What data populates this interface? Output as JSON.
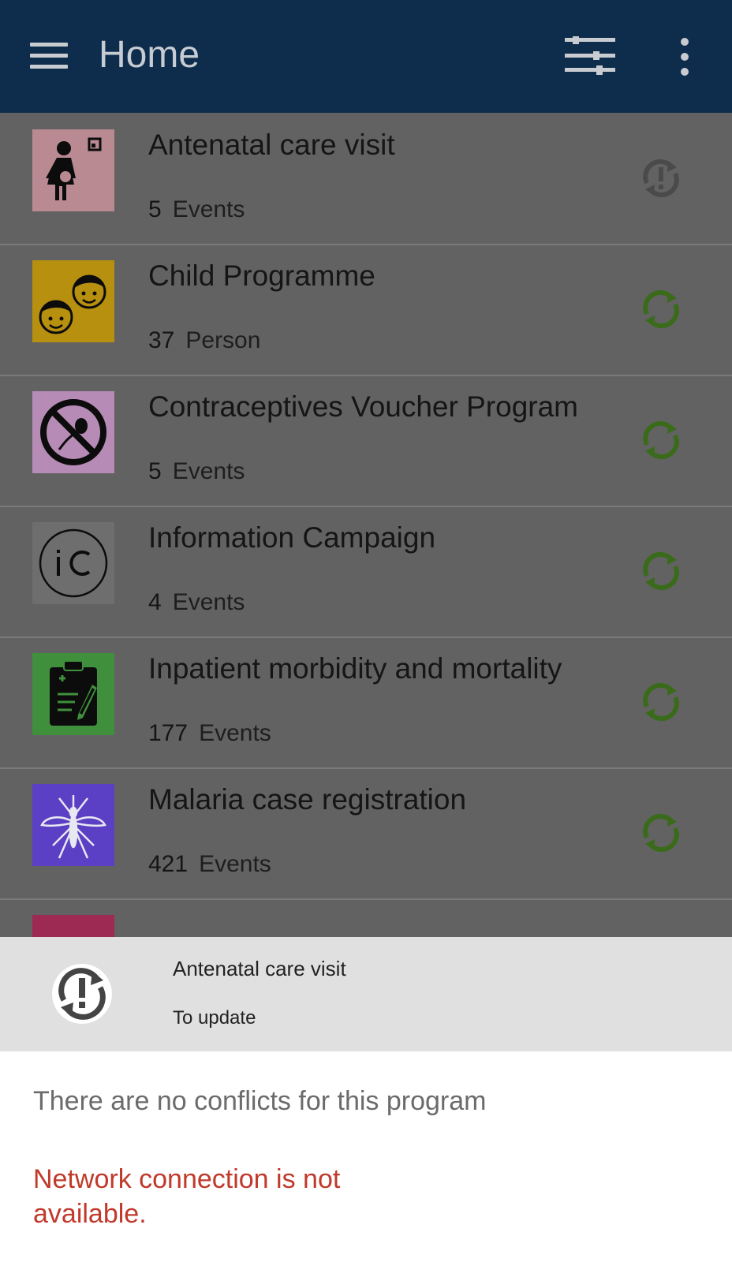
{
  "toolbar": {
    "title": "Home",
    "menu_icon": "hamburger-menu-icon",
    "filter_icon": "filter-sliders-icon",
    "more_icon": "more-vertical-icon"
  },
  "programs": [
    {
      "name": "Antenatal care visit",
      "count": "5",
      "unit": "Events",
      "icon": "pregnant-woman-icon",
      "icon_bg": "#b98a92",
      "sync_status": "to-update",
      "sync_color": "#4a4a4a"
    },
    {
      "name": "Child Programme",
      "count": "37",
      "unit": "Person",
      "icon": "children-faces-icon",
      "icon_bg": "#b8900f",
      "sync_status": "synced",
      "sync_color": "#3a6b1a"
    },
    {
      "name": "Contraceptives Voucher Program",
      "count": "5",
      "unit": "Events",
      "icon": "no-sperm-icon",
      "icon_bg": "#b68bb6",
      "sync_status": "synced",
      "sync_color": "#3a6b1a"
    },
    {
      "name": "Information Campaign",
      "count": "4",
      "unit": "Events",
      "icon": "ic-letters-icon",
      "icon_bg": "#6e6e6e",
      "sync_status": "synced",
      "sync_color": "#3a6b1a"
    },
    {
      "name": "Inpatient morbidity and mortality",
      "count": "177",
      "unit": "Events",
      "icon": "clipboard-icon",
      "icon_bg": "#3f8f3c",
      "sync_status": "synced",
      "sync_color": "#3a6b1a"
    },
    {
      "name": "Malaria case registration",
      "count": "421",
      "unit": "Events",
      "icon": "mosquito-icon",
      "icon_bg": "#5b3fc4",
      "sync_status": "synced",
      "sync_color": "#3a6b1a"
    }
  ],
  "sheet": {
    "icon": "sync-warning-icon",
    "program_name": "Antenatal care visit",
    "state": "To update",
    "no_conflicts": "There are no conflicts for this program",
    "network_error": "Network connection is not available."
  },
  "colors": {
    "toolbar_bg": "#0e2c4c",
    "scrim": "#626262",
    "error": "#c0392b"
  }
}
